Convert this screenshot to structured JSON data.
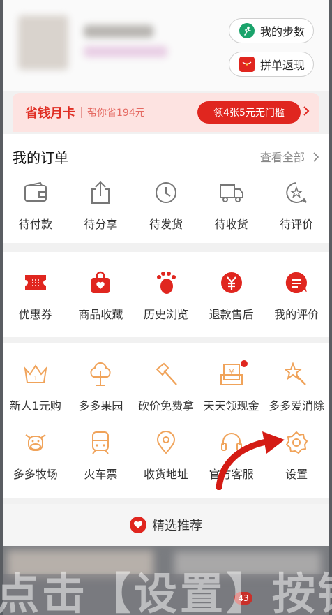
{
  "header": {
    "steps_label": "我的步数",
    "group_label": "拼单返现"
  },
  "savings_card": {
    "title": "省钱月卡",
    "subtitle": "帮你省194元",
    "button": "领4张5元无门槛"
  },
  "orders": {
    "title": "我的订单",
    "view_all": "查看全部",
    "items": [
      {
        "label": "待付款",
        "icon": "wallet-icon"
      },
      {
        "label": "待分享",
        "icon": "share-icon"
      },
      {
        "label": "待发货",
        "icon": "clock-icon"
      },
      {
        "label": "待收货",
        "icon": "truck-icon"
      },
      {
        "label": "待评价",
        "icon": "review-bubble-icon"
      }
    ]
  },
  "tools": {
    "items": [
      {
        "label": "优惠券",
        "icon": "coupon-icon"
      },
      {
        "label": "商品收藏",
        "icon": "bag-heart-icon"
      },
      {
        "label": "历史浏览",
        "icon": "footprint-icon"
      },
      {
        "label": "退款售后",
        "icon": "yuan-icon"
      },
      {
        "label": "我的评价",
        "icon": "comment-icon"
      }
    ]
  },
  "services": {
    "row1": [
      {
        "label": "新人1元购",
        "icon": "crown-icon"
      },
      {
        "label": "多多果园",
        "icon": "tree-icon"
      },
      {
        "label": "砍价免费拿",
        "icon": "axe-icon"
      },
      {
        "label": "天天领现金",
        "icon": "cash-envelope-icon"
      },
      {
        "label": "多多爱消除",
        "icon": "star-wand-icon"
      }
    ],
    "row2": [
      {
        "label": "多多牧场",
        "icon": "cow-icon"
      },
      {
        "label": "火车票",
        "icon": "train-icon"
      },
      {
        "label": "收货地址",
        "icon": "location-icon"
      },
      {
        "label": "官方客服",
        "icon": "headset-icon"
      },
      {
        "label": "设置",
        "icon": "gear-icon"
      }
    ]
  },
  "recommend": {
    "label": "精选推荐"
  },
  "overlay_caption": "点击【设置】按钮",
  "tabbar": {
    "badge": "43"
  },
  "colors": {
    "brand_red": "#e0261f",
    "icon_orange": "#f0a35a",
    "card_bg": "#fde3e1"
  }
}
